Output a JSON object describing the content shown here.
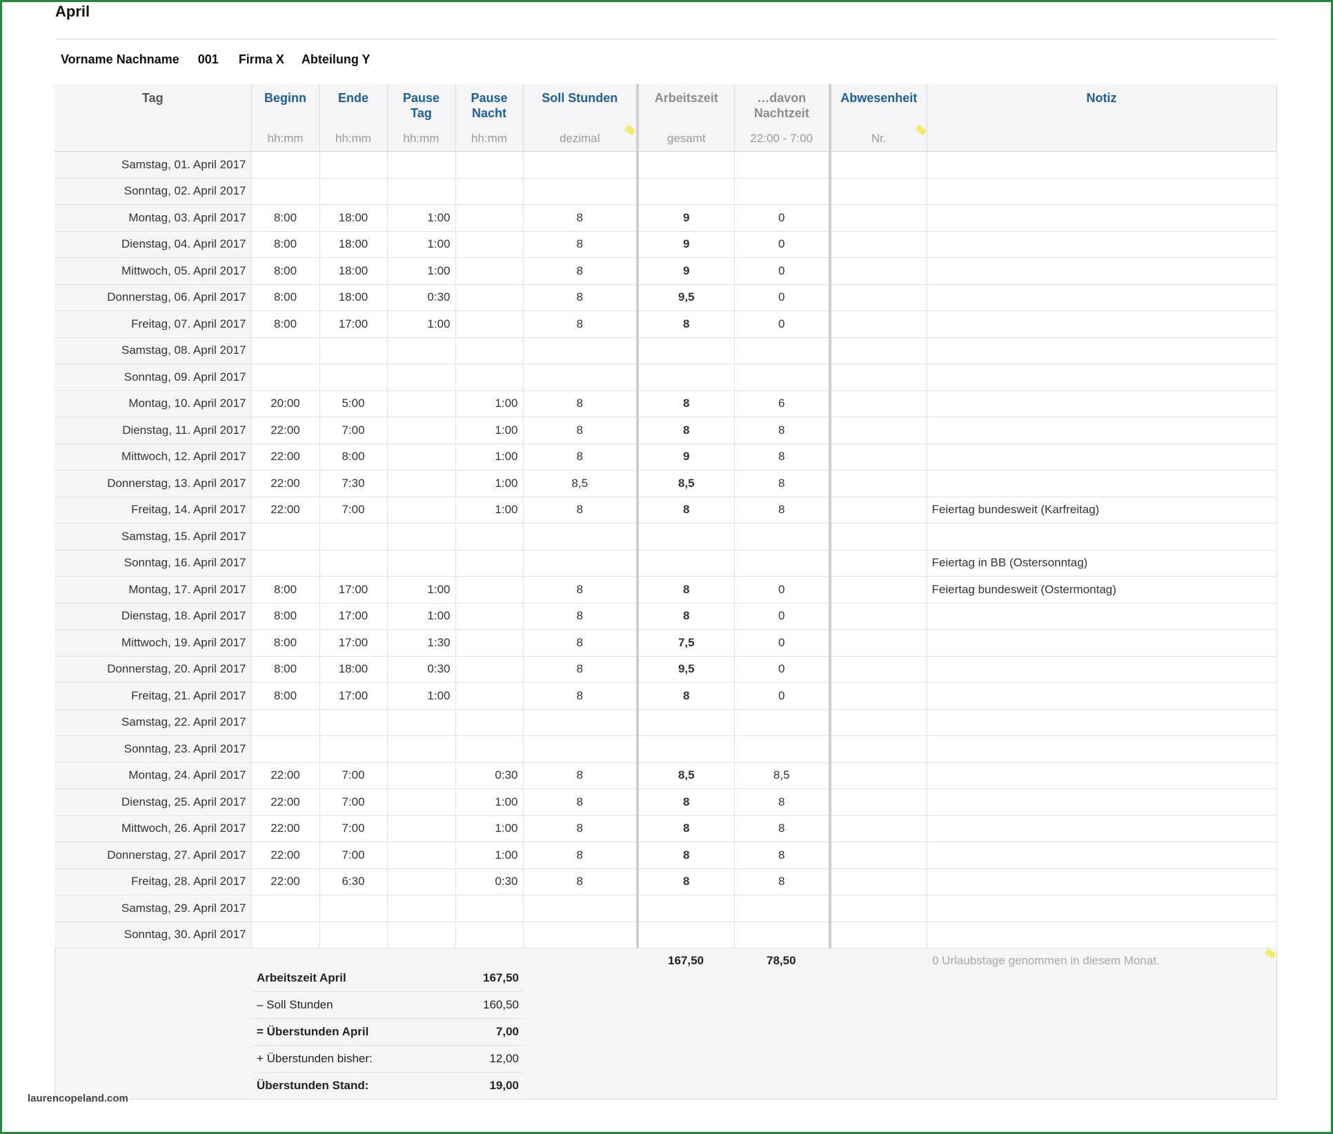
{
  "title": "April",
  "employee": {
    "name": "Vorname Nachname",
    "number": "001",
    "company": "Firma X",
    "department": "Abteilung Y"
  },
  "columns": [
    {
      "label": "Tag",
      "unit": ""
    },
    {
      "label": "Beginn",
      "unit": "hh:mm"
    },
    {
      "label": "Ende",
      "unit": "hh:mm"
    },
    {
      "label": "Pause\nTag",
      "unit": "hh:mm"
    },
    {
      "label": "Pause\nNacht",
      "unit": "hh:mm"
    },
    {
      "label": "Soll Stunden",
      "unit": "dezimal"
    },
    {
      "label": "Arbeitszeit",
      "unit": "gesamt"
    },
    {
      "label": "…davon\nNachtzeit",
      "unit": "22:00 - 7:00"
    },
    {
      "label": "Abwesenheit",
      "unit": "Nr."
    },
    {
      "label": "Notiz",
      "unit": ""
    }
  ],
  "rows": [
    [
      "Samstag, 01. April 2017",
      "",
      "",
      "",
      "",
      "",
      "",
      "",
      "",
      ""
    ],
    [
      "Sonntag, 02. April 2017",
      "",
      "",
      "",
      "",
      "",
      "",
      "",
      "",
      ""
    ],
    [
      "Montag, 03. April 2017",
      "8:00",
      "18:00",
      "1:00",
      "",
      "8",
      "9",
      "0",
      "",
      ""
    ],
    [
      "Dienstag, 04. April 2017",
      "8:00",
      "18:00",
      "1:00",
      "",
      "8",
      "9",
      "0",
      "",
      ""
    ],
    [
      "Mittwoch, 05. April 2017",
      "8:00",
      "18:00",
      "1:00",
      "",
      "8",
      "9",
      "0",
      "",
      ""
    ],
    [
      "Donnerstag, 06. April 2017",
      "8:00",
      "18:00",
      "0:30",
      "",
      "8",
      "9,5",
      "0",
      "",
      ""
    ],
    [
      "Freitag, 07. April 2017",
      "8:00",
      "17:00",
      "1:00",
      "",
      "8",
      "8",
      "0",
      "",
      ""
    ],
    [
      "Samstag, 08. April 2017",
      "",
      "",
      "",
      "",
      "",
      "",
      "",
      "",
      ""
    ],
    [
      "Sonntag, 09. April 2017",
      "",
      "",
      "",
      "",
      "",
      "",
      "",
      "",
      ""
    ],
    [
      "Montag, 10. April 2017",
      "20:00",
      "5:00",
      "",
      "1:00",
      "8",
      "8",
      "6",
      "",
      ""
    ],
    [
      "Dienstag, 11. April 2017",
      "22:00",
      "7:00",
      "",
      "1:00",
      "8",
      "8",
      "8",
      "",
      ""
    ],
    [
      "Mittwoch, 12. April 2017",
      "22:00",
      "8:00",
      "",
      "1:00",
      "8",
      "9",
      "8",
      "",
      ""
    ],
    [
      "Donnerstag, 13. April 2017",
      "22:00",
      "7:30",
      "",
      "1:00",
      "8,5",
      "8,5",
      "8",
      "",
      ""
    ],
    [
      "Freitag, 14. April 2017",
      "22:00",
      "7:00",
      "",
      "1:00",
      "8",
      "8",
      "8",
      "",
      "Feiertag bundesweit (Karfreitag)"
    ],
    [
      "Samstag, 15. April 2017",
      "",
      "",
      "",
      "",
      "",
      "",
      "",
      "",
      ""
    ],
    [
      "Sonntag, 16. April 2017",
      "",
      "",
      "",
      "",
      "",
      "",
      "",
      "",
      "Feiertag in BB (Ostersonntag)"
    ],
    [
      "Montag, 17. April 2017",
      "8:00",
      "17:00",
      "1:00",
      "",
      "8",
      "8",
      "0",
      "",
      "Feiertag bundesweit (Ostermontag)"
    ],
    [
      "Dienstag, 18. April 2017",
      "8:00",
      "17:00",
      "1:00",
      "",
      "8",
      "8",
      "0",
      "",
      ""
    ],
    [
      "Mittwoch, 19. April 2017",
      "8:00",
      "17:00",
      "1:30",
      "",
      "8",
      "7,5",
      "0",
      "",
      ""
    ],
    [
      "Donnerstag, 20. April 2017",
      "8:00",
      "18:00",
      "0:30",
      "",
      "8",
      "9,5",
      "0",
      "",
      ""
    ],
    [
      "Freitag, 21. April 2017",
      "8:00",
      "17:00",
      "1:00",
      "",
      "8",
      "8",
      "0",
      "",
      ""
    ],
    [
      "Samstag, 22. April 2017",
      "",
      "",
      "",
      "",
      "",
      "",
      "",
      "",
      ""
    ],
    [
      "Sonntag, 23. April 2017",
      "",
      "",
      "",
      "",
      "",
      "",
      "",
      "",
      ""
    ],
    [
      "Montag, 24. April 2017",
      "22:00",
      "7:00",
      "",
      "0:30",
      "8",
      "8,5",
      "8,5",
      "",
      ""
    ],
    [
      "Dienstag, 25. April 2017",
      "22:00",
      "7:00",
      "",
      "1:00",
      "8",
      "8",
      "8",
      "",
      ""
    ],
    [
      "Mittwoch, 26. April 2017",
      "22:00",
      "7:00",
      "",
      "1:00",
      "8",
      "8",
      "8",
      "",
      ""
    ],
    [
      "Donnerstag, 27. April 2017",
      "22:00",
      "7:00",
      "",
      "1:00",
      "8",
      "8",
      "8",
      "",
      ""
    ],
    [
      "Freitag, 28. April 2017",
      "22:00",
      "6:30",
      "",
      "0:30",
      "8",
      "8",
      "8",
      "",
      ""
    ],
    [
      "Samstag, 29. April 2017",
      "",
      "",
      "",
      "",
      "",
      "",
      "",
      "",
      ""
    ],
    [
      "Sonntag, 30. April 2017",
      "",
      "",
      "",
      "",
      "",
      "",
      "",
      "",
      ""
    ]
  ],
  "totals": {
    "arbeitszeit": "167,50",
    "nachtzeit": "78,50",
    "vacation_note": "0 Urlaubstage genommen in diesem Monat."
  },
  "summary": [
    {
      "label": "Arbeitszeit April",
      "value": "167,50",
      "bold": true
    },
    {
      "label": "– Soll Stunden",
      "value": "160,50",
      "bold": false
    },
    {
      "label": "= Überstunden April",
      "value": "7,00",
      "bold": true
    },
    {
      "label": "+ Überstunden bisher:",
      "value": "12,00",
      "bold": false
    },
    {
      "label": "Überstunden Stand:",
      "value": "19,00",
      "bold": true
    }
  ],
  "watermark": "laurencopeland.com"
}
